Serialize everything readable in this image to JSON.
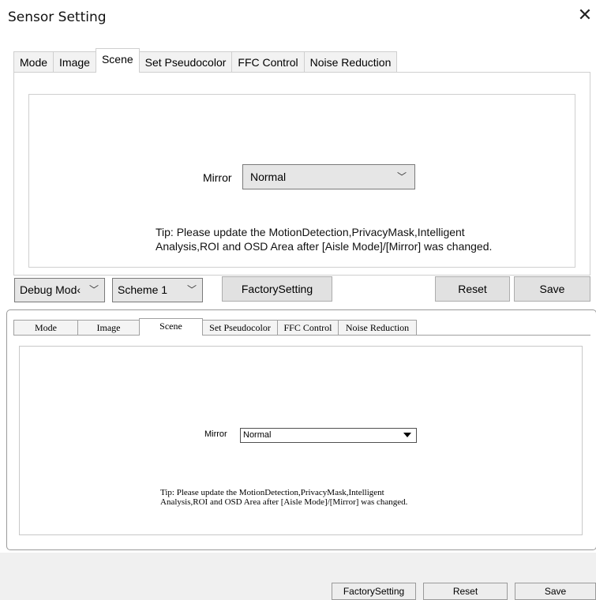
{
  "dialog": {
    "title": "Sensor Setting",
    "close_glyph": "✕",
    "tabs": [
      "Mode",
      "Image",
      "Scene",
      "Set Pseudocolor",
      "FFC Control",
      "Noise Reduction"
    ],
    "active_tab": "Scene",
    "mirror_label": "Mirror",
    "mirror_value": "Normal",
    "tip_line1": "Tip: Please update the MotionDetection,PrivacyMask,Intelligent",
    "tip_line2": "Analysis,ROI and OSD Area after [Aisle Mode]/[Mirror] was changed.",
    "debug_mode_value": "Debug Mod‹",
    "scheme_value": "Scheme 1",
    "factory_label": "FactorySetting",
    "reset_label": "Reset",
    "save_label": "Save",
    "chevron_glyph": "﹀"
  },
  "classic": {
    "tabs": [
      "Mode",
      "Image",
      "Scene",
      "Set Pseudocolor",
      "FFC Control",
      "Noise Reduction"
    ],
    "active_tab": "Scene",
    "mirror_label": "Mirror",
    "mirror_value": "Normal",
    "tip_line1": "Tip: Please update the MotionDetection,PrivacyMask,Intelligent",
    "tip_line2": "Analysis,ROI and OSD Area after [Aisle Mode]/[Mirror] was changed.",
    "factory_label": "FactorySetting",
    "reset_label": "Reset",
    "save_label": "Save"
  },
  "icons": {
    "close": "close-icon",
    "dropdown": "chevron-down-icon",
    "dropdown_classic": "triangle-down-icon"
  }
}
